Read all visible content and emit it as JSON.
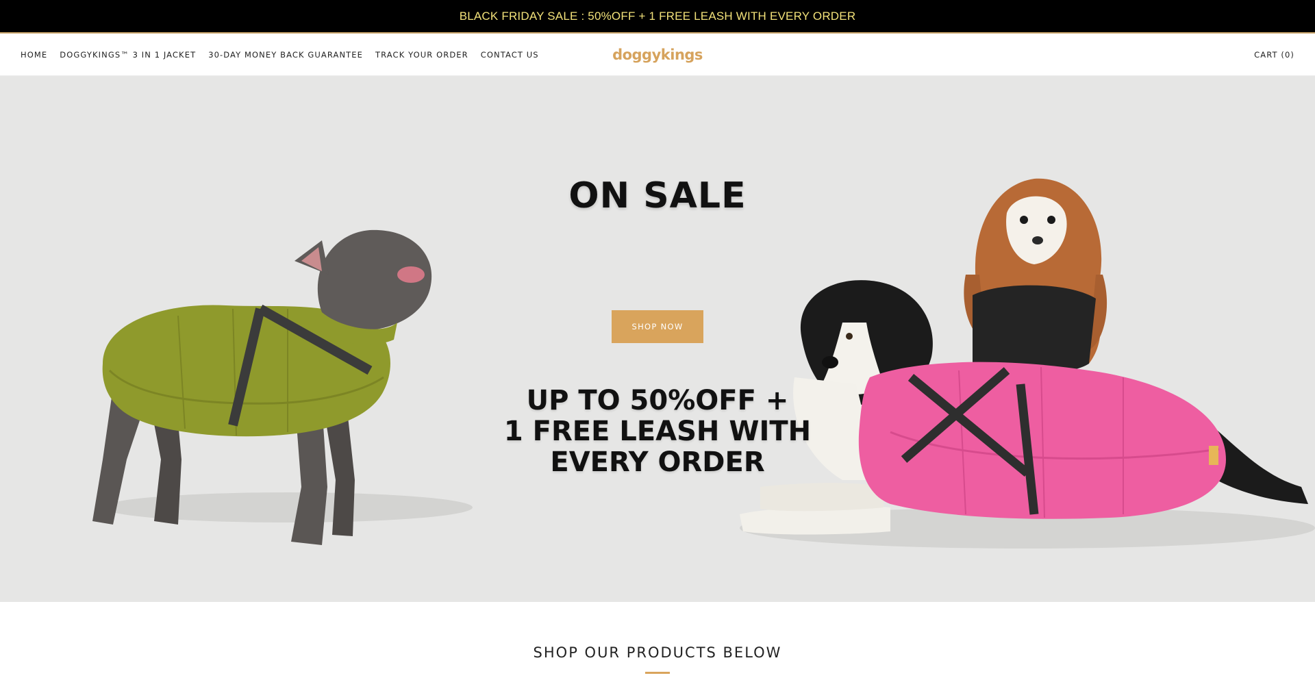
{
  "announcement": {
    "text": "BLACK FRIDAY SALE : 50%OFF + 1 FREE LEASH WITH EVERY ORDER"
  },
  "header": {
    "nav": [
      {
        "label": "HOME"
      },
      {
        "label": "DOGGYKINGS™ 3 IN 1 JACKET"
      },
      {
        "label": "30-DAY MONEY BACK GUARANTEE"
      },
      {
        "label": "TRACK YOUR ORDER"
      },
      {
        "label": "CONTACT US"
      }
    ],
    "logo": "doggykings",
    "cart": "CART (0)"
  },
  "hero": {
    "title": "ON SALE",
    "button": "SHOP NOW",
    "subtitle_lines": [
      "UP TO 50%OFF +",
      "1 FREE LEASH WITH",
      "EVERY ORDER"
    ]
  },
  "section": {
    "title": "SHOP OUR PRODUCTS BELOW"
  },
  "colors": {
    "announcement_bg": "#000000",
    "announcement_text": "#f3e27a",
    "accent": "#d9a45c",
    "hero_bg": "#e6e6e5",
    "green_jacket": "#8f9a2c",
    "pink_jacket": "#ee5ea1"
  }
}
